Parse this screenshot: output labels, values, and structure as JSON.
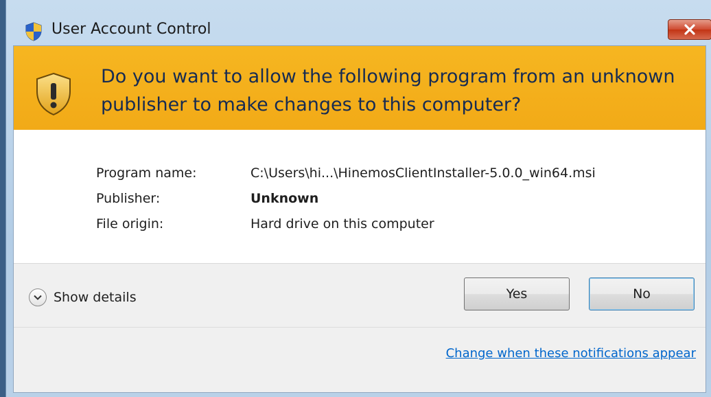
{
  "window": {
    "title": "User Account Control",
    "close_icon": "close-x-icon"
  },
  "banner": {
    "question": "Do you want to allow the following program from an unknown publisher to make changes to this computer?",
    "icon": "uac-shield-warning-icon"
  },
  "details": {
    "rows": [
      {
        "label": "Program name:",
        "value": "C:\\Users\\hi...\\HinemosClientInstaller-5.0.0_win64.msi",
        "bold": false
      },
      {
        "label": "Publisher:",
        "value": "Unknown",
        "bold": true
      },
      {
        "label": "File origin:",
        "value": "Hard drive on this computer",
        "bold": false
      }
    ]
  },
  "footer": {
    "show_details_label": "Show details",
    "yes_label": "Yes",
    "no_label": "No",
    "change_link": "Change when these notifications appear"
  },
  "colors": {
    "banner": "#f4b01c",
    "link": "#0066cc",
    "close_button": "#c9432a"
  }
}
